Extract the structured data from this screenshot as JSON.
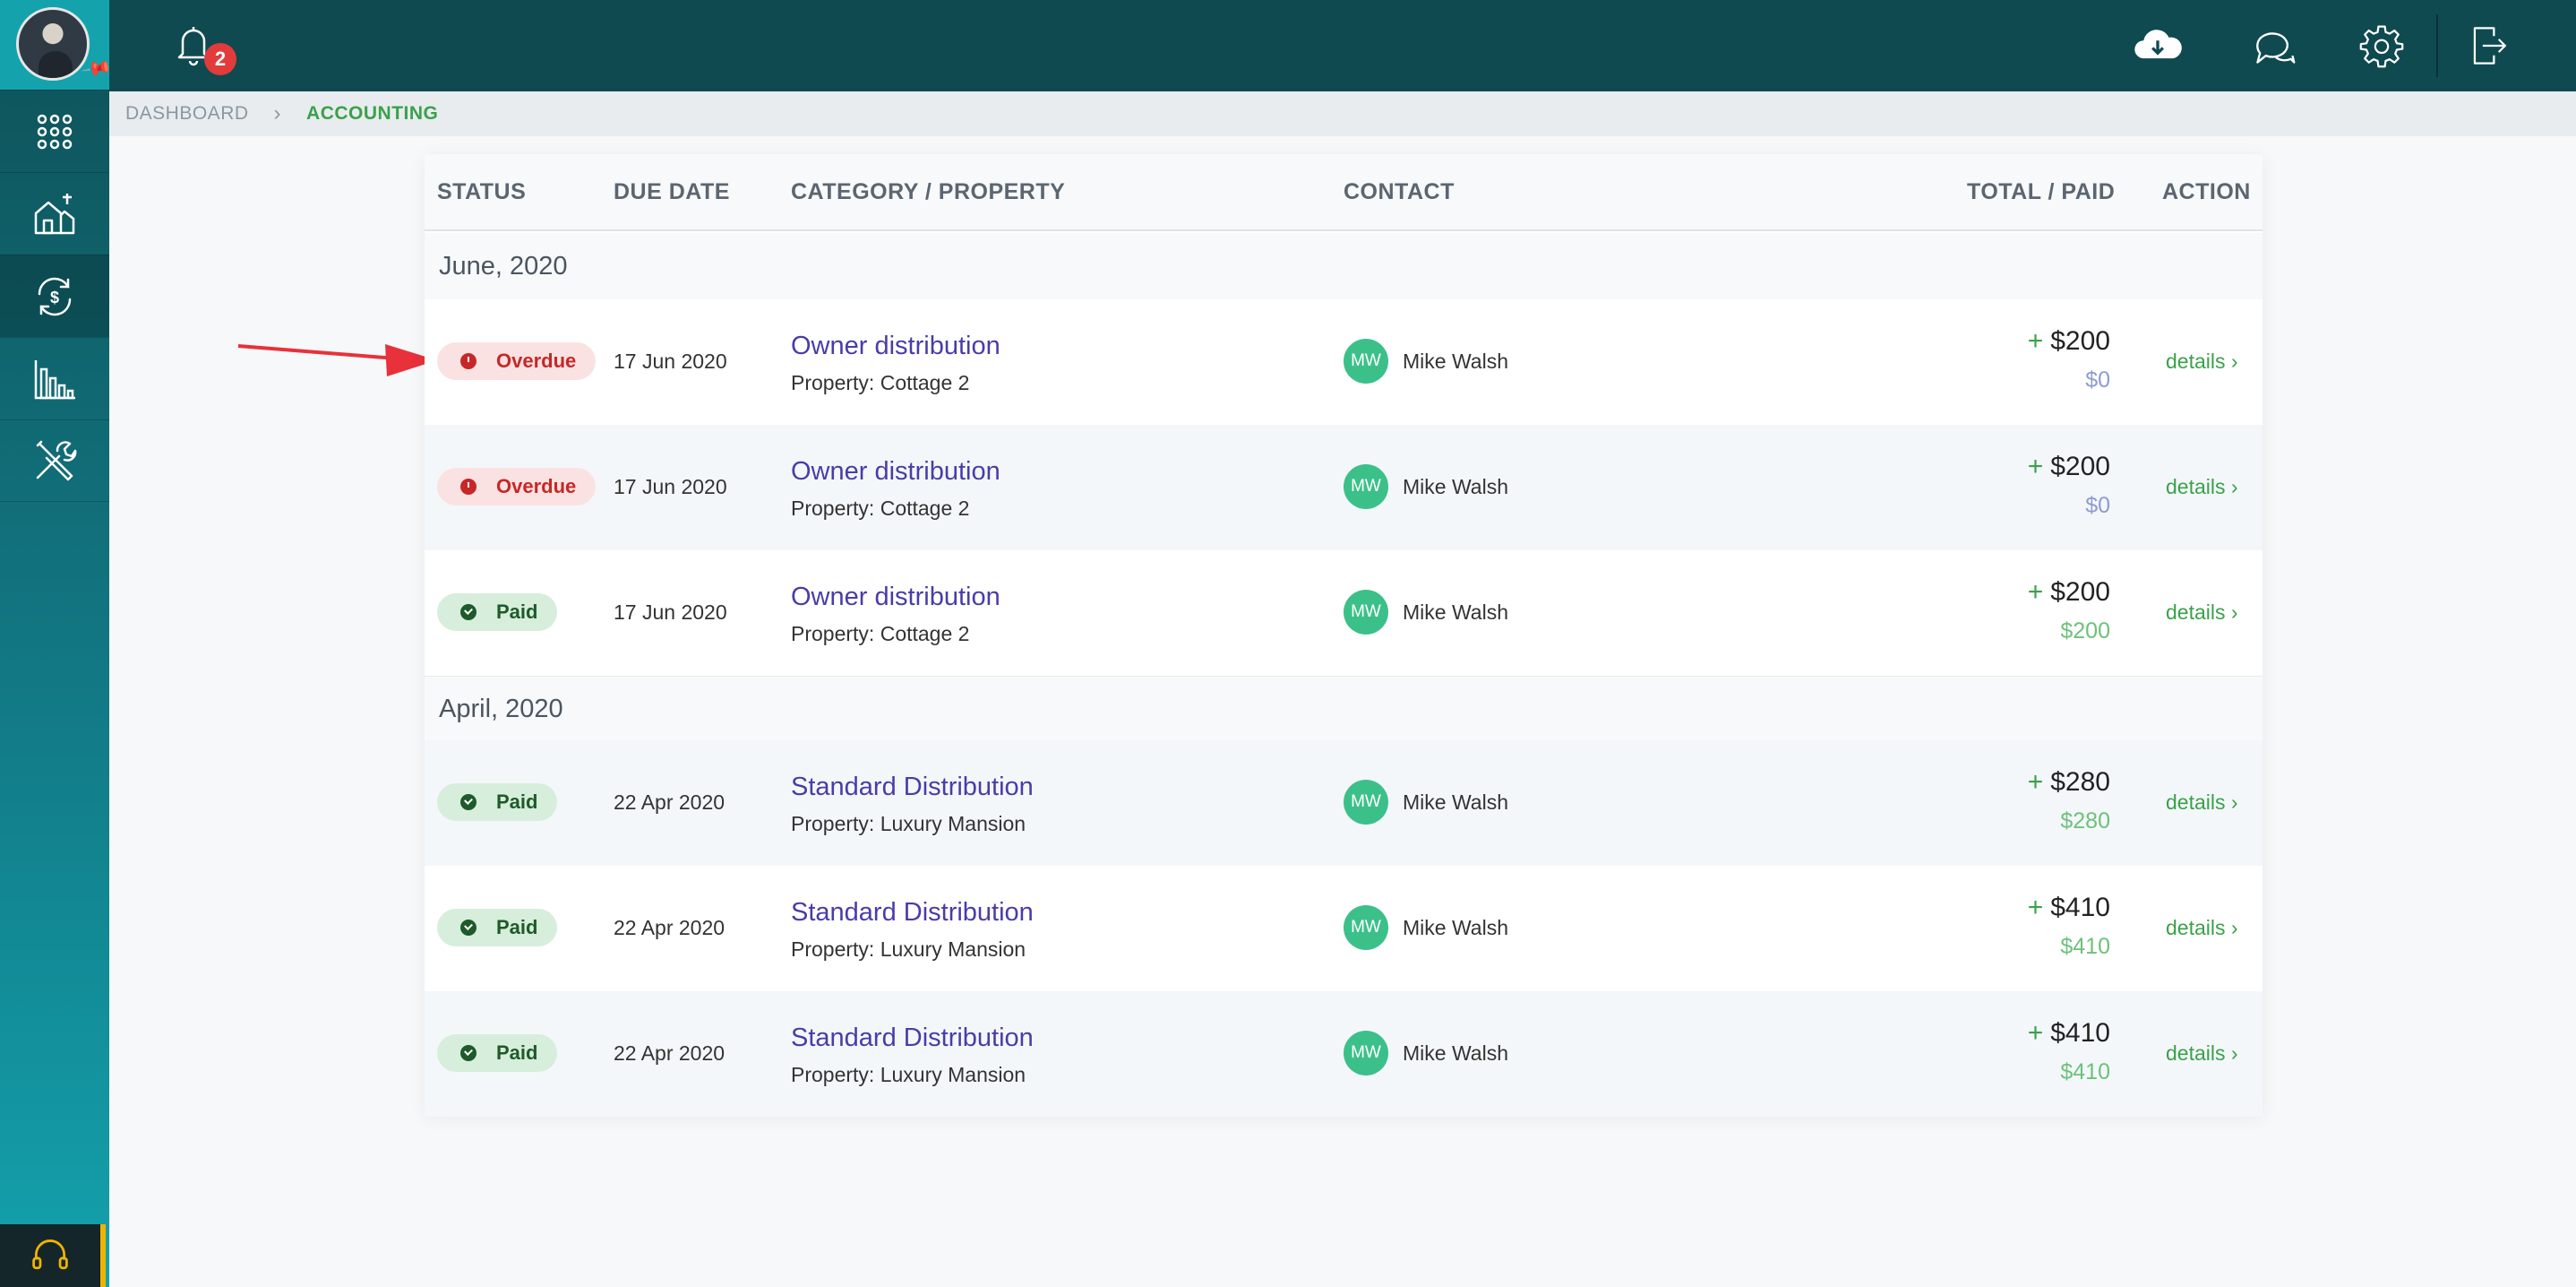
{
  "topbar": {
    "notification_count": "2"
  },
  "sidebar": {
    "items": [
      {
        "name": "apps"
      },
      {
        "name": "properties"
      },
      {
        "name": "accounting"
      },
      {
        "name": "reports"
      },
      {
        "name": "tools"
      }
    ]
  },
  "breadcrumb": {
    "root": "DASHBOARD",
    "separator": "›",
    "current": "ACCOUNTING"
  },
  "table": {
    "headers": {
      "status": "STATUS",
      "due_date": "DUE DATE",
      "category": "CATEGORY / PROPERTY",
      "contact": "CONTACT",
      "total": "TOTAL / PAID",
      "action": "ACTION"
    },
    "groups": [
      {
        "label": "June, 2020"
      },
      {
        "label": "April, 2020"
      }
    ],
    "rows": [
      {
        "status": "Overdue",
        "due": "17 Jun 2020",
        "category": "Owner distribution",
        "property": "Property: Cottage 2",
        "initials": "MW",
        "contact": "Mike Walsh",
        "plus": "+",
        "total": "$200",
        "paid": "$0",
        "action": "details ›"
      },
      {
        "status": "Overdue",
        "due": "17 Jun 2020",
        "category": "Owner distribution",
        "property": "Property: Cottage 2",
        "initials": "MW",
        "contact": "Mike Walsh",
        "plus": "+",
        "total": "$200",
        "paid": "$0",
        "action": "details ›"
      },
      {
        "status": "Paid",
        "due": "17 Jun 2020",
        "category": "Owner distribution",
        "property": "Property: Cottage 2",
        "initials": "MW",
        "contact": "Mike Walsh",
        "plus": "+",
        "total": "$200",
        "paid": "$200",
        "action": "details ›"
      },
      {
        "status": "Paid",
        "due": "22 Apr 2020",
        "category": "Standard Distribution",
        "property": "Property: Luxury Mansion",
        "initials": "MW",
        "contact": "Mike Walsh",
        "plus": "+",
        "total": "$280",
        "paid": "$280",
        "action": "details ›"
      },
      {
        "status": "Paid",
        "due": "22 Apr 2020",
        "category": "Standard Distribution",
        "property": "Property: Luxury Mansion",
        "initials": "MW",
        "contact": "Mike Walsh",
        "plus": "+",
        "total": "$410",
        "paid": "$410",
        "action": "details ›"
      },
      {
        "status": "Paid",
        "due": "22 Apr 2020",
        "category": "Standard Distribution",
        "property": "Property: Luxury Mansion",
        "initials": "MW",
        "contact": "Mike Walsh",
        "plus": "+",
        "total": "$410",
        "paid": "$410",
        "action": "details ›"
      }
    ]
  },
  "colors": {
    "topbar": "#0f4a50",
    "accent_green": "#3aa14a",
    "overdue_red": "#c62828",
    "link_purple": "#4a3ca8",
    "contact_green": "#3cc08a",
    "annotation_arrow": "#e8313a"
  }
}
